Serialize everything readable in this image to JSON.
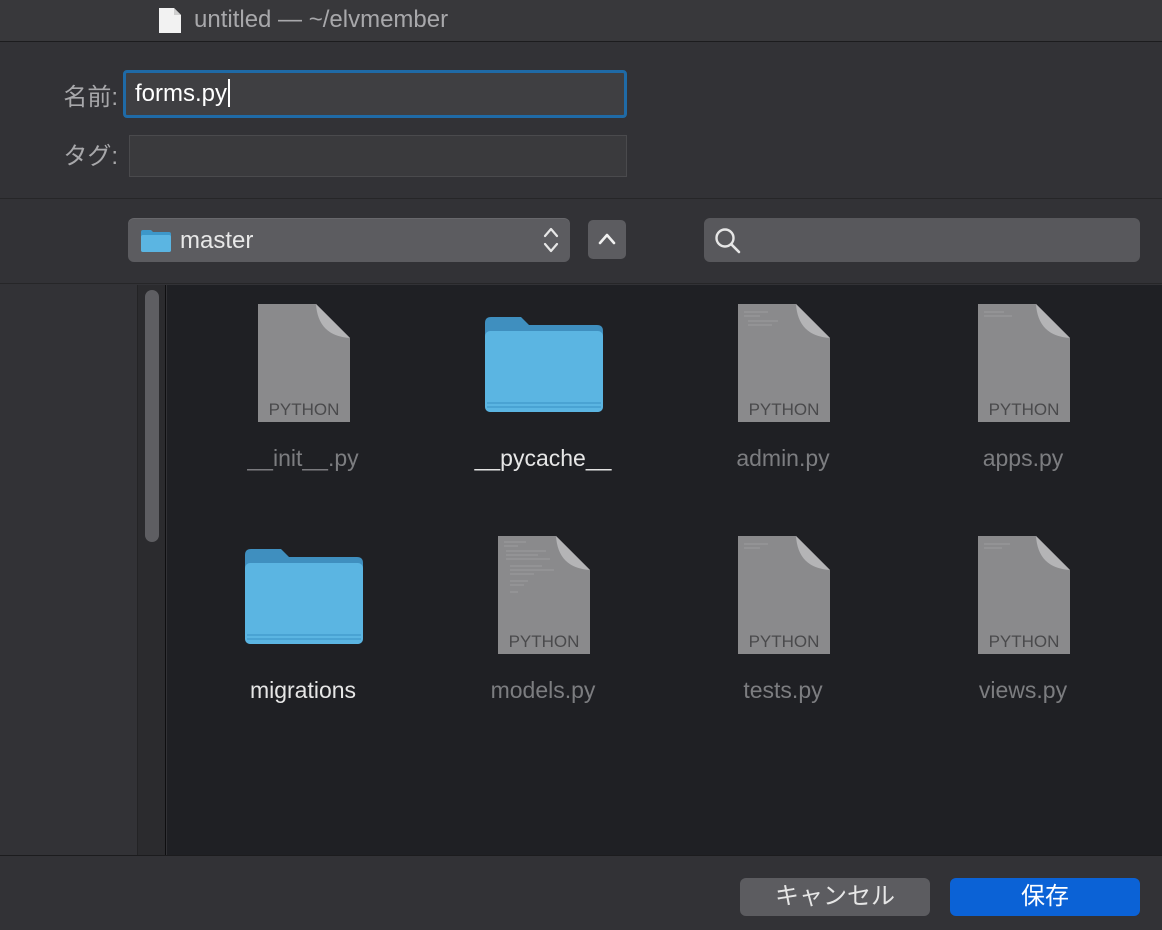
{
  "window": {
    "title": "untitled — ~/elvmember"
  },
  "form": {
    "name_label": "名前:",
    "name_value": "forms.py",
    "tags_label": "タグ:",
    "tags_value": ""
  },
  "toolbar": {
    "location": "master",
    "search_placeholder": ""
  },
  "files": [
    {
      "name": "__init__.py",
      "kind": "python",
      "badge": "PYTHON"
    },
    {
      "name": "__pycache__",
      "kind": "folder"
    },
    {
      "name": "admin.py",
      "kind": "python",
      "badge": "PYTHON"
    },
    {
      "name": "apps.py",
      "kind": "python",
      "badge": "PYTHON"
    },
    {
      "name": "migrations",
      "kind": "folder"
    },
    {
      "name": "models.py",
      "kind": "python",
      "badge": "PYTHON"
    },
    {
      "name": "tests.py",
      "kind": "python",
      "badge": "PYTHON"
    },
    {
      "name": "views.py",
      "kind": "python",
      "badge": "PYTHON"
    }
  ],
  "footer": {
    "cancel_label": "キャンセル",
    "save_label": "保存"
  },
  "colors": {
    "accent": "#0b62d6",
    "focus_ring": "#1f6aa6",
    "folder": "#5bb5e2"
  }
}
